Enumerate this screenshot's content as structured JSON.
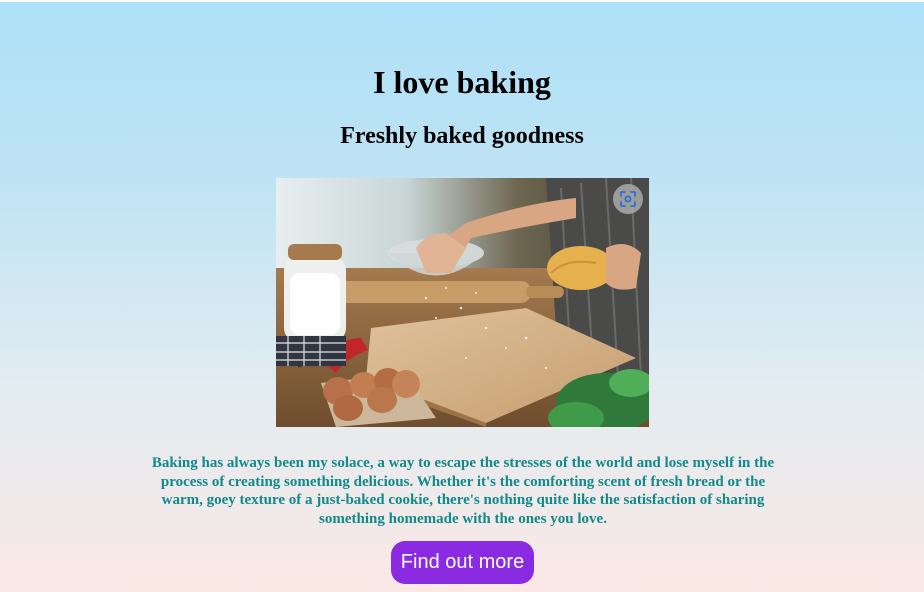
{
  "header": {
    "title": "I love baking",
    "subtitle": "Freshly baked goodness"
  },
  "hero_image": {
    "alt": "Hands kneading dough on a floured wooden board with eggs, flour jar and rolling pin",
    "lens_icon": "visual-search-icon"
  },
  "content": {
    "paragraph": "Baking has always been my solace, a way to escape the stresses of the world and lose myself in the process of creating something delicious. Whether it's the comforting scent of fresh bread or the warm, goey texture of a just-baked cookie, there's nothing quite like the satisfaction of sharing something homemade with the ones you love."
  },
  "cta": {
    "label": "Find out more",
    "color": "#8a2be2"
  },
  "colors": {
    "paragraph_text": "#108a8a",
    "background_top": "#ade0f7",
    "background_bottom": "#fbe8e5"
  }
}
